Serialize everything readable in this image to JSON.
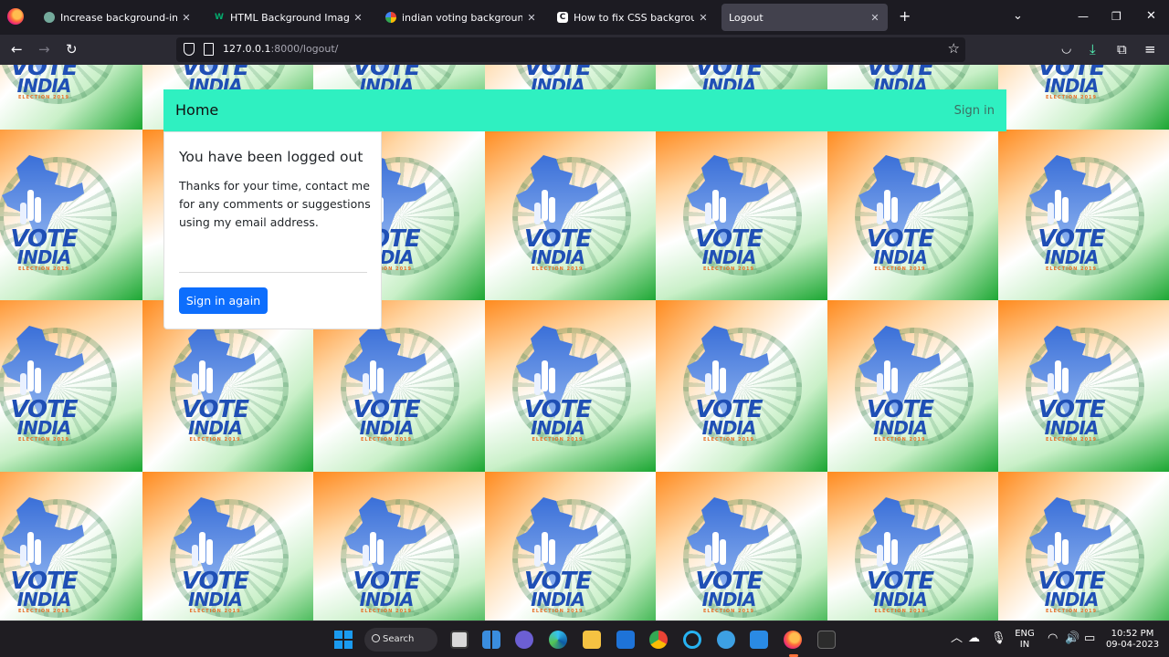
{
  "browser": {
    "tabs": [
      {
        "title": "Increase background-image size",
        "favicon": "chatgpt-icon",
        "active": false
      },
      {
        "title": "HTML Background Images",
        "favicon": "w3schools-icon",
        "active": false
      },
      {
        "title": "indian voting background image",
        "favicon": "google-icon",
        "active": false
      },
      {
        "title": "How to fix CSS background-image",
        "favicon": "css-tricks-icon",
        "active": false
      },
      {
        "title": "Logout",
        "favicon": "none",
        "active": true
      }
    ],
    "url_host": "127.0.0.1",
    "url_rest": ":8000/logout/"
  },
  "page": {
    "nav_brand": "Home",
    "nav_signin": "Sign in",
    "card_title": "You have been logged out",
    "card_message": "Thanks for your time, contact me for any comments or suggestions using my email address.",
    "card_button": "Sign in again",
    "tile": {
      "line1": "VOTE",
      "line2": "INDIA",
      "line3": "ELECTION 2019"
    },
    "colors": {
      "navbar": "#2ff0c1",
      "button": "#0d6efd",
      "saffron": "#ff8a1e",
      "green": "#1aa631",
      "blue": "#1f4fb5"
    }
  },
  "taskbar": {
    "search_label": "Search",
    "lang_line1": "ENG",
    "lang_line2": "IN",
    "time": "10:52 PM",
    "date": "09-04-2023"
  }
}
